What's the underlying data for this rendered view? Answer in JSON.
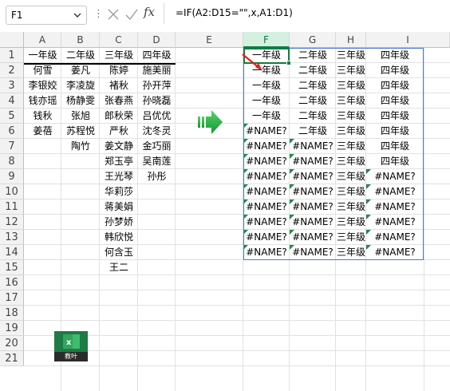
{
  "namebox": {
    "value": "F1"
  },
  "formula_bar": {
    "formula": "=IF(A2:D15=\"\",x,A1:D1)",
    "fx_label": "fx"
  },
  "columns": [
    "A",
    "B",
    "C",
    "D",
    "E",
    "F",
    "G",
    "H",
    "I"
  ],
  "selected_column": "F",
  "rows": [
    "1",
    "2",
    "3",
    "4",
    "5",
    "6",
    "7",
    "8",
    "9",
    "10",
    "11",
    "12",
    "13",
    "14",
    "15",
    "16",
    "17",
    "18",
    "19",
    "20",
    "21"
  ],
  "source": {
    "A": [
      "一年级",
      "何雪",
      "李银姣",
      "钱亦瑶",
      "钱秋",
      "姜蓓"
    ],
    "B": [
      "二年级",
      "姜凡",
      "李凌旋",
      "杨静雯",
      "张旭",
      "苏程悦",
      "陶竹"
    ],
    "C": [
      "三年级",
      "陈婷",
      "褚秋",
      "张春燕",
      "郎秋荣",
      "严秋",
      "姜文静",
      "郑玉亭",
      "王光琴",
      "华莉莎",
      "蒋美娟",
      "孙梦娇",
      "韩欣悦",
      "何含玉",
      "王二"
    ],
    "D": [
      "四年级",
      "施美丽",
      "孙开萍",
      "孙晓磊",
      "吕优优",
      "沈冬灵",
      "金巧丽",
      "吴南莲",
      "孙彤"
    ]
  },
  "result": {
    "F": [
      "一年级",
      "一年级",
      "一年级",
      "一年级",
      "一年级",
      "#NAME?",
      "#NAME?",
      "#NAME?",
      "#NAME?",
      "#NAME?",
      "#NAME?",
      "#NAME?",
      "#NAME?",
      "#NAME?"
    ],
    "G": [
      "二年级",
      "二年级",
      "二年级",
      "二年级",
      "二年级",
      "二年级",
      "#NAME?",
      "#NAME?",
      "#NAME?",
      "#NAME?",
      "#NAME?",
      "#NAME?",
      "#NAME?",
      "#NAME?"
    ],
    "H": [
      "三年级",
      "三年级",
      "三年级",
      "三年级",
      "三年级",
      "三年级",
      "三年级",
      "三年级",
      "三年级",
      "三年级",
      "三年级",
      "三年级",
      "三年级",
      "三年级"
    ],
    "I": [
      "四年级",
      "四年级",
      "四年级",
      "四年级",
      "四年级",
      "四年级",
      "四年级",
      "四年级",
      "#NAME?",
      "#NAME?",
      "#NAME?",
      "#NAME?",
      "#NAME?",
      "#NAME?"
    ]
  },
  "logo": {
    "caption": "教叶"
  },
  "colors": {
    "excel_green": "#107c41",
    "arrow_green": "#21b04b",
    "arrow_red": "#e81c1c",
    "range_blue": "#4a7bc8"
  },
  "icons": [
    "chevron-down-icon",
    "more-dots-icon",
    "cancel-x-icon",
    "confirm-check-icon",
    "function-fx-icon",
    "right-arrow-icon",
    "red-pointer-arrow-icon",
    "excel-logo-icon"
  ]
}
